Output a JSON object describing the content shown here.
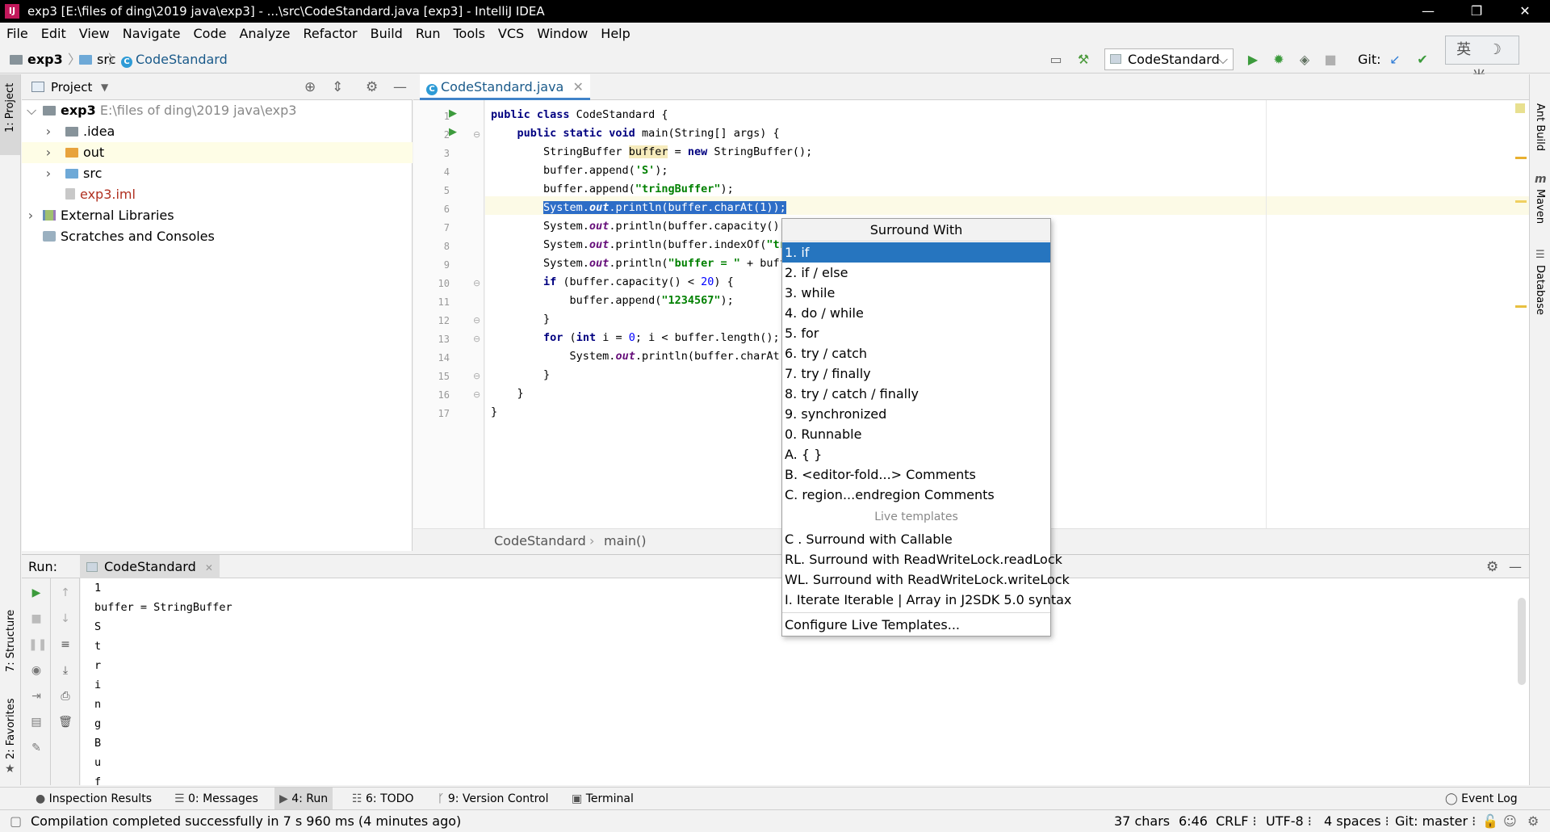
{
  "window": {
    "title": "exp3 [E:\\files of ding\\2019 java\\exp3] - ...\\src\\CodeStandard.java [exp3] - IntelliJ IDEA",
    "logo_text": "IJ",
    "controls": [
      "—",
      "❐",
      "✕"
    ]
  },
  "menu": [
    "File",
    "Edit",
    "View",
    "Navigate",
    "Code",
    "Analyze",
    "Refactor",
    "Build",
    "Run",
    "Tools",
    "VCS",
    "Window",
    "Help"
  ],
  "navbar": {
    "crumbs": [
      "exp3",
      "src",
      "CodeStandard"
    ],
    "run_config": "CodeStandard",
    "git_label": "Git:"
  },
  "ime": {
    "text": "英 ☽ 半"
  },
  "side_tabs": {
    "left": [
      "1: Project",
      "7: Structure",
      "2: Favorites"
    ],
    "right": [
      "Ant Build",
      "Maven",
      "Database"
    ]
  },
  "project": {
    "header": "Project",
    "tree": [
      {
        "label": "exp3",
        "extra": "E:\\files of ding\\2019 java\\exp3",
        "depth": 0,
        "expanded": true,
        "icon": "folder-grey"
      },
      {
        "label": ".idea",
        "depth": 1,
        "expanded": false,
        "icon": "folder-grey"
      },
      {
        "label": "out",
        "depth": 1,
        "expanded": false,
        "icon": "folder-orange"
      },
      {
        "label": "src",
        "depth": 1,
        "expanded": false,
        "icon": "folder-blue"
      },
      {
        "label": "exp3.iml",
        "depth": 2,
        "icon": "iml-file"
      },
      {
        "label": "External Libraries",
        "depth": 0,
        "expanded": false,
        "icon": "library"
      },
      {
        "label": "Scratches and Consoles",
        "depth": 0,
        "icon": "scratch"
      }
    ]
  },
  "editor": {
    "tab": "CodeStandard.java",
    "line_numbers": [
      "1",
      "2",
      "3",
      "4",
      "5",
      "6",
      "7",
      "8",
      "9",
      "10",
      "11",
      "12",
      "13",
      "14",
      "15",
      "16",
      "17"
    ],
    "breadcrumb": [
      "CodeStandard",
      "main()"
    ]
  },
  "popup": {
    "title": "Surround With",
    "items": [
      "1. if",
      "2. if / else",
      "3. while",
      "4. do / while",
      "5. for",
      "6. try / catch",
      "7. try / finally",
      "8. try / catch / finally",
      "9. synchronized",
      "0. Runnable",
      "A. { }",
      "B. <editor-fold...> Comments",
      "C. region...endregion Comments"
    ],
    "live_label": "Live templates",
    "live_items": [
      "C . Surround with Callable",
      "RL. Surround with ReadWriteLock.readLock",
      "WL. Surround with ReadWriteLock.writeLock",
      "I. Iterate Iterable | Array in J2SDK 5.0 syntax"
    ],
    "configure": "Configure Live Templates..."
  },
  "run": {
    "label": "Run:",
    "tab": "CodeStandard",
    "output": [
      "1",
      "buffer = StringBuffer",
      "S",
      "t",
      "r",
      "i",
      "n",
      "g",
      "B",
      "u",
      "f"
    ]
  },
  "bottom_tabs": [
    "Inspection Results",
    "0: Messages",
    "4: Run",
    "6: TODO",
    "9: Version Control",
    "Terminal"
  ],
  "event_log": "Event Log",
  "status": {
    "message": "Compilation completed successfully in 7 s 960 ms (4 minutes ago)",
    "chars": "37 chars",
    "position": "6:46",
    "line_sep": "CRLF ⁝",
    "encoding": "UTF-8 ⁝",
    "indent": "4 spaces ⁝",
    "git": "Git: master ⁝"
  }
}
